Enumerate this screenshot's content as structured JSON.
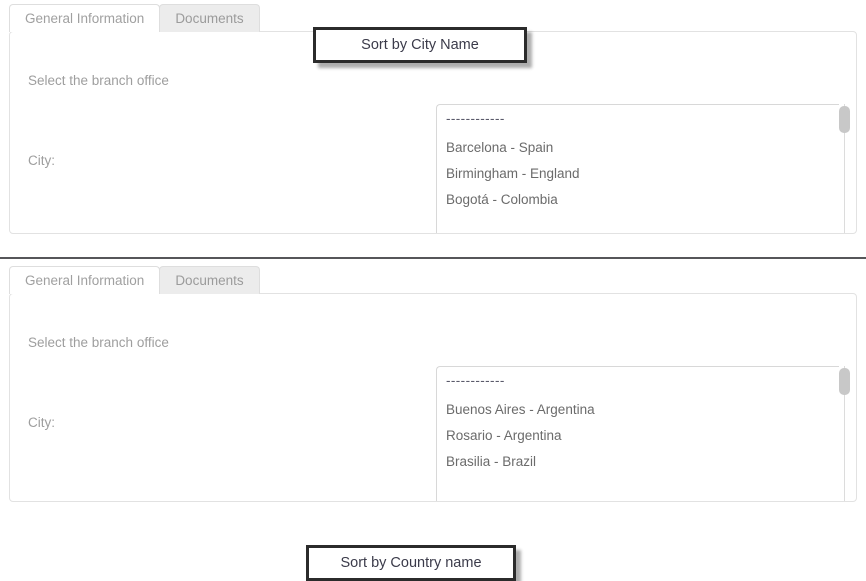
{
  "colors": {
    "callout_border": "#2b2b2b",
    "tab_active_bg": "#ffffff",
    "tab_inactive_bg": "#ececec",
    "panel_border": "#e2e2e2",
    "text_muted": "#9e9e9e",
    "list_text": "#6b6b6b",
    "scroll_thumb": "#c8c8c8",
    "divider": "#565659"
  },
  "sections": [
    {
      "id": "section-1",
      "tabs": [
        {
          "label": "General Information",
          "active": true
        },
        {
          "label": "Documents",
          "active": false
        }
      ],
      "callout": "Sort by City Name",
      "labels": {
        "branch": "Select the branch office",
        "city": "City:"
      },
      "listbox": {
        "separator": "------------",
        "options": [
          "Barcelona - Spain",
          "Birmingham - England",
          "Bogotá - Colombia"
        ],
        "scrollbar": "vertical-scrollbar"
      }
    },
    {
      "id": "section-2",
      "tabs": [
        {
          "label": "General Information",
          "active": true
        },
        {
          "label": "Documents",
          "active": false
        }
      ],
      "callout": "Sort by Country name",
      "labels": {
        "branch": "Select the branch office",
        "city": "City:"
      },
      "listbox": {
        "separator": "------------",
        "options": [
          "Buenos Aires - Argentina",
          "Rosario - Argentina",
          "Brasilia - Brazil"
        ],
        "scrollbar": "vertical-scrollbar"
      }
    }
  ]
}
